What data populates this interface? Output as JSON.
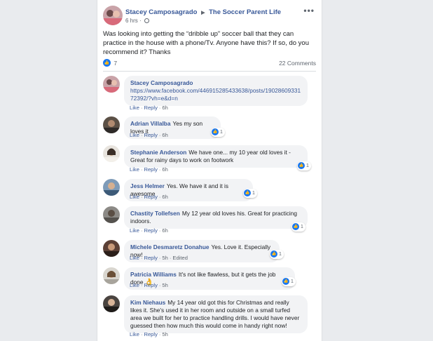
{
  "post": {
    "author": "Stacey Camposagrado",
    "group": "The Soccer Parent Life",
    "time": "6 hrs",
    "text": "Was looking into getting the “dribble up” soccer ball that they can practice in the house with a phone/Tv. Anyone have this? If so, do you recommend it? Thanks",
    "likes": "7",
    "comments_count": "22 Comments"
  },
  "actions": {
    "like": "Like",
    "reply": "Reply",
    "edited": "Edited"
  },
  "comments": [
    {
      "author": "Stacey Camposagrado",
      "text": "https://www.facebook.com/446915285433638/posts/1902860933172392/?vh=e&d=n",
      "time": "6h"
    },
    {
      "author": "Adrian Villalba",
      "text": "Yes my son loves it",
      "time": "6h",
      "reactions": "1"
    },
    {
      "author": "Stephanie Anderson",
      "text": "We have one... my 10 year old loves it - Great for rainy days to work on footwork",
      "time": "6h",
      "reactions": "1"
    },
    {
      "author": "Jess Helmer",
      "text": "Yes. We have it and it is awesome",
      "time": "6h",
      "reactions": "1"
    },
    {
      "author": "Chastity Tollefsen",
      "text": "My 12 year old loves his. Great for practicing indoors.",
      "time": "6h",
      "reactions": "1"
    },
    {
      "author": "Michele Desmaretz Donahue",
      "text": "Yes. Love it. Especially now!",
      "time": "5h",
      "reactions": "1"
    },
    {
      "author": "Patricia Williams",
      "text": "It's not like flawless, but it gets the job done",
      "emoji": "👌",
      "time": "5h",
      "reactions": "1"
    },
    {
      "author": "Kim Niehaus",
      "text": "My 14 year old got this for Christmas and really likes it. She's used it in her room and outside on a small turfed area we built for her to practice handling drills. I would have never guessed then how much this would come in handy right now!",
      "time": "5h"
    }
  ]
}
